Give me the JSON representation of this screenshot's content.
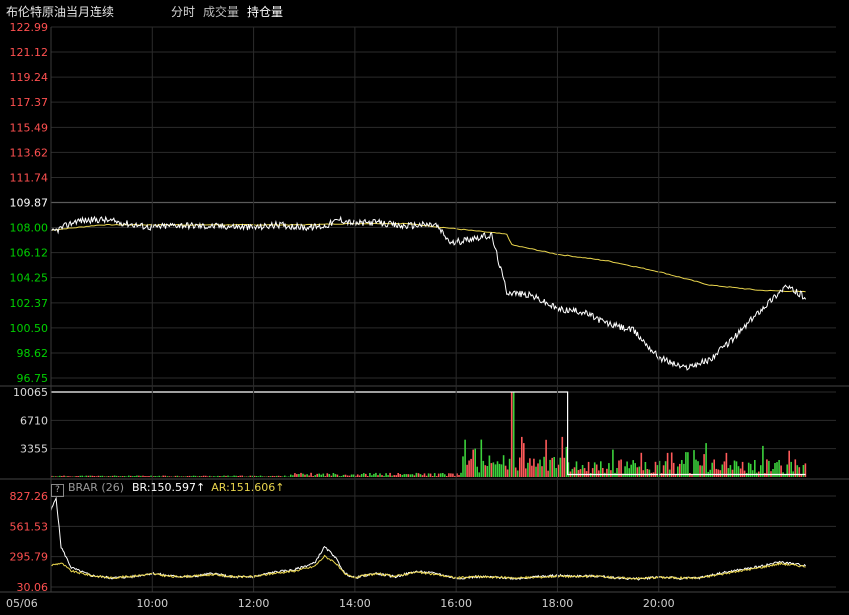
{
  "header": {
    "title": "布伦特原油当月连续",
    "tabs": [
      "分时",
      "成交量",
      "持仓量"
    ]
  },
  "colors": {
    "background": "#000000",
    "price_line": "#ffffff",
    "avg_line": "#e8d44d",
    "up_label": "#ff5050",
    "down_label": "#00d000",
    "vol_up": "#ff5a5a",
    "vol_down": "#3cd23c",
    "grid": "#2b2b2b"
  },
  "indicator": {
    "help_glyph": "?",
    "name": "BRAR (26)",
    "br_label": "BR:150.597↑",
    "ar_label": "AR:151.606↑"
  },
  "chart_data": [
    {
      "type": "line",
      "name": "price",
      "yticks": [
        "122.99",
        "121.12",
        "119.24",
        "117.37",
        "115.49",
        "113.62",
        "111.74",
        "109.87",
        "108.00",
        "106.12",
        "104.25",
        "102.37",
        "100.50",
        "98.62",
        "96.75"
      ],
      "reference": 109.87,
      "ylim": [
        96.75,
        122.99
      ],
      "series": [
        {
          "name": "",
          "kind": "price",
          "x": [
            0,
            0.5,
            1,
            1.5,
            2,
            2.5,
            3,
            3.5,
            4,
            4.5,
            5,
            5.4,
            5.7,
            6,
            6.4,
            6.9,
            7.3,
            7.6,
            7.9,
            8.3,
            8.7,
            9,
            9.5,
            10,
            10.5,
            11,
            11.5,
            12,
            12.5,
            13,
            13.5,
            14,
            14.5,
            14.9
          ],
          "y": [
            107.6,
            108.5,
            108.6,
            108.3,
            108.0,
            108.2,
            108.1,
            108.1,
            108.0,
            108.2,
            108.0,
            108.1,
            108.6,
            108.3,
            108.4,
            108.1,
            108.2,
            108.2,
            106.8,
            107.2,
            107.4,
            103.2,
            102.9,
            101.9,
            101.7,
            100.8,
            100.3,
            98.3,
            97.5,
            98.1,
            99.8,
            101.8,
            103.6,
            102.8
          ]
        },
        {
          "name": "",
          "kind": "average",
          "x": [
            0,
            1,
            2,
            3,
            4,
            5,
            6,
            7,
            8,
            9,
            9.1,
            10,
            11,
            12,
            13,
            14,
            14.9
          ],
          "y": [
            107.8,
            108.2,
            108.2,
            108.2,
            108.2,
            108.2,
            108.3,
            108.3,
            107.9,
            107.5,
            106.7,
            106.0,
            105.5,
            104.7,
            103.7,
            103.3,
            103.2
          ]
        }
      ]
    },
    {
      "type": "bar",
      "name": "volume",
      "yticks": [
        "10065",
        "6710",
        "3355"
      ],
      "ylim": [
        0,
        10065
      ],
      "open_interest": {
        "x": [
          0,
          10.2,
          10.2,
          14.9
        ],
        "y": [
          10065,
          10065,
          300,
          300
        ]
      },
      "bars_x_range": [
        0,
        14.9
      ],
      "spike_x": 9.1,
      "spike_value": 10065
    },
    {
      "type": "line",
      "name": "BRAR",
      "yticks": [
        "827.26",
        "561.53",
        "295.79",
        "30.06"
      ],
      "ylim": [
        30.06,
        827.26
      ],
      "series": [
        {
          "name": "BR",
          "x": [
            0,
            0.1,
            0.2,
            0.4,
            0.8,
            1.2,
            1.6,
            2,
            2.4,
            2.8,
            3.2,
            3.6,
            4,
            4.4,
            4.8,
            5.2,
            5.4,
            5.6,
            5.8,
            6,
            6.4,
            6.8,
            7.2,
            7.6,
            8,
            8.4,
            8.8,
            9.2,
            9.6,
            10,
            10.4,
            10.8,
            11.2,
            11.6,
            12,
            12.4,
            12.8,
            13.2,
            13.6,
            14,
            14.4,
            14.7,
            14.9
          ],
          "y": [
            700,
            810,
            380,
            200,
            130,
            110,
            120,
            150,
            125,
            120,
            150,
            115,
            120,
            160,
            180,
            240,
            380,
            300,
            150,
            110,
            150,
            120,
            165,
            150,
            105,
            120,
            115,
            105,
            120,
            130,
            125,
            125,
            110,
            100,
            120,
            105,
            110,
            150,
            180,
            210,
            250,
            230,
            220
          ]
        },
        {
          "name": "AR",
          "x": [
            0,
            0.2,
            0.4,
            0.8,
            1.2,
            1.6,
            2,
            2.4,
            2.8,
            3.2,
            3.6,
            4,
            4.4,
            4.8,
            5.2,
            5.4,
            5.6,
            5.8,
            6,
            6.4,
            6.8,
            7.2,
            7.6,
            8,
            8.4,
            8.8,
            9.2,
            9.6,
            10,
            10.4,
            10.8,
            11.2,
            11.6,
            12,
            12.4,
            12.8,
            13.2,
            13.6,
            14,
            14.4,
            14.7,
            14.9
          ],
          "y": [
            220,
            240,
            170,
            130,
            110,
            125,
            145,
            120,
            125,
            140,
            120,
            120,
            150,
            170,
            210,
            300,
            250,
            140,
            115,
            145,
            125,
            160,
            140,
            110,
            120,
            115,
            110,
            115,
            125,
            120,
            125,
            110,
            105,
            115,
            110,
            110,
            140,
            170,
            200,
            235,
            220,
            210
          ]
        }
      ]
    }
  ],
  "xaxis": {
    "ticks": [
      {
        "x": 0,
        "label": "05/06"
      },
      {
        "x": 2,
        "label": "10:00"
      },
      {
        "x": 4,
        "label": "12:00"
      },
      {
        "x": 6,
        "label": "14:00"
      },
      {
        "x": 8,
        "label": "16:00"
      },
      {
        "x": 10,
        "label": "18:00"
      },
      {
        "x": 12,
        "label": "20:00"
      }
    ],
    "range": [
      0,
      15.5
    ]
  }
}
